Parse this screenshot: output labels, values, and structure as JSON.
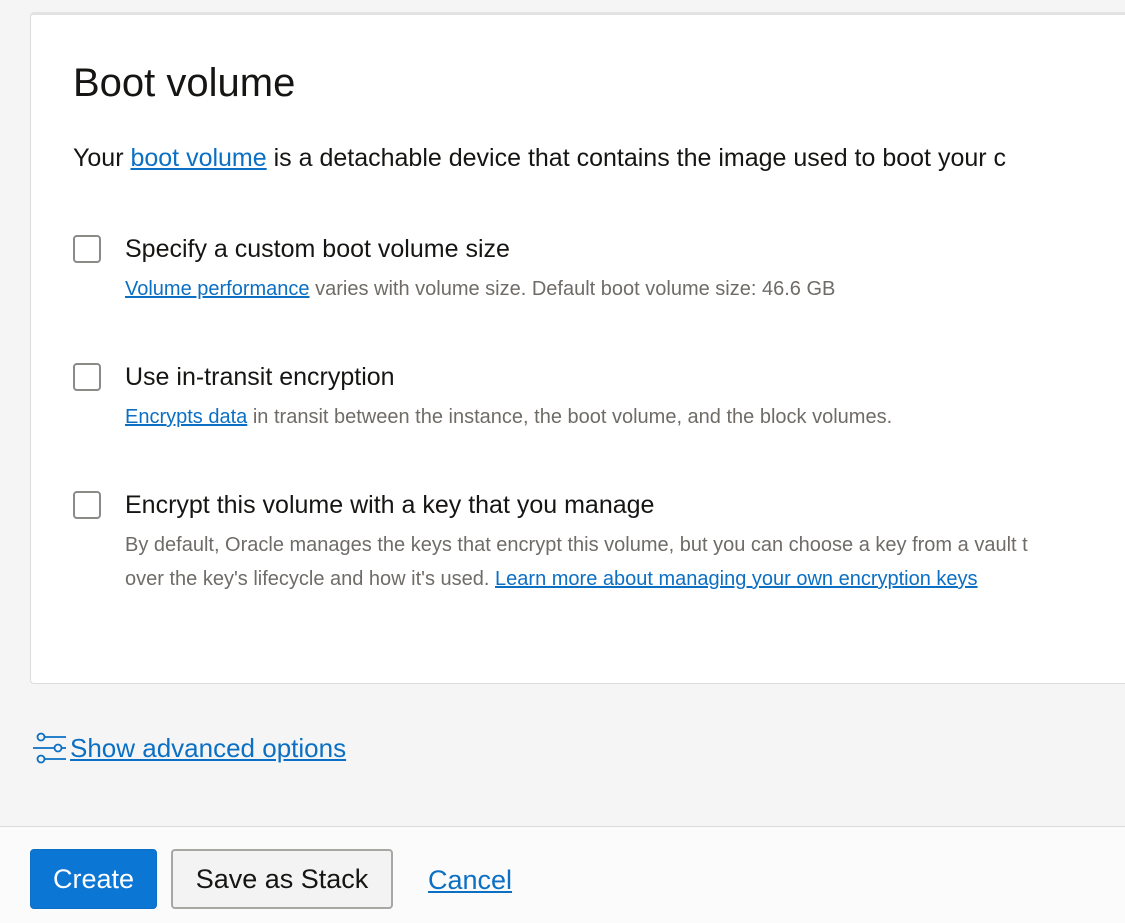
{
  "boot_volume": {
    "title": "Boot volume",
    "intro": {
      "prefix": "Your ",
      "link": "boot volume",
      "suffix": " is a detachable device that contains the image used to boot your c"
    },
    "options": [
      {
        "label": "Specify a custom boot volume size",
        "help_link": "Volume performance",
        "help_text": " varies with volume size. Default boot volume size: 46.6 GB",
        "checked": false
      },
      {
        "label": "Use in-transit encryption",
        "help_link": "Encrypts data",
        "help_text": " in transit between the instance, the boot volume, and the block volumes.",
        "checked": false
      },
      {
        "label": "Encrypt this volume with a key that you manage",
        "help_line1": "By default, Oracle manages the keys that encrypt this volume, but you can choose a key from a vault t",
        "help_line2": "over the key's lifecycle and how it's used. ",
        "help_link": "Learn more about managing your own encryption keys",
        "checked": false
      }
    ]
  },
  "advanced": {
    "icon": "sliders-icon",
    "label": "Show advanced options"
  },
  "footer": {
    "create_label": "Create",
    "save_stack_label": "Save as Stack",
    "cancel_label": "Cancel"
  },
  "colors": {
    "link": "#0b6fc4",
    "primary_button": "#0b76d4",
    "help_text": "#6f6c68",
    "background": "#f5f5f5"
  }
}
